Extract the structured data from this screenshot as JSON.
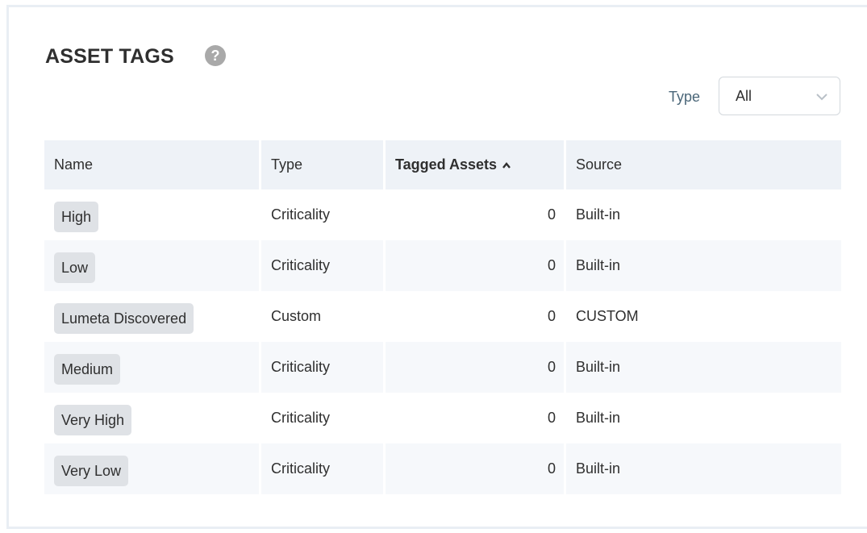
{
  "header": {
    "title": "ASSET TAGS",
    "help_icon": "question-circle-icon"
  },
  "filter": {
    "label": "Type",
    "selected": "All",
    "icon": "chevron-down-icon"
  },
  "table": {
    "columns": [
      "Name",
      "Type",
      "Tagged Assets",
      "Source"
    ],
    "sorted_column": "Tagged Assets",
    "sort_direction": "ascending",
    "rows": [
      {
        "name": "High",
        "type": "Criticality",
        "tagged_assets": "0",
        "source": "Built-in"
      },
      {
        "name": "Low",
        "type": "Criticality",
        "tagged_assets": "0",
        "source": "Built-in"
      },
      {
        "name": "Lumeta Discovered",
        "type": "Custom",
        "tagged_assets": "0",
        "source": "CUSTOM"
      },
      {
        "name": "Medium",
        "type": "Criticality",
        "tagged_assets": "0",
        "source": "Built-in"
      },
      {
        "name": "Very High",
        "type": "Criticality",
        "tagged_assets": "0",
        "source": "Built-in"
      },
      {
        "name": "Very Low",
        "type": "Criticality",
        "tagged_assets": "0",
        "source": "Built-in"
      }
    ]
  }
}
